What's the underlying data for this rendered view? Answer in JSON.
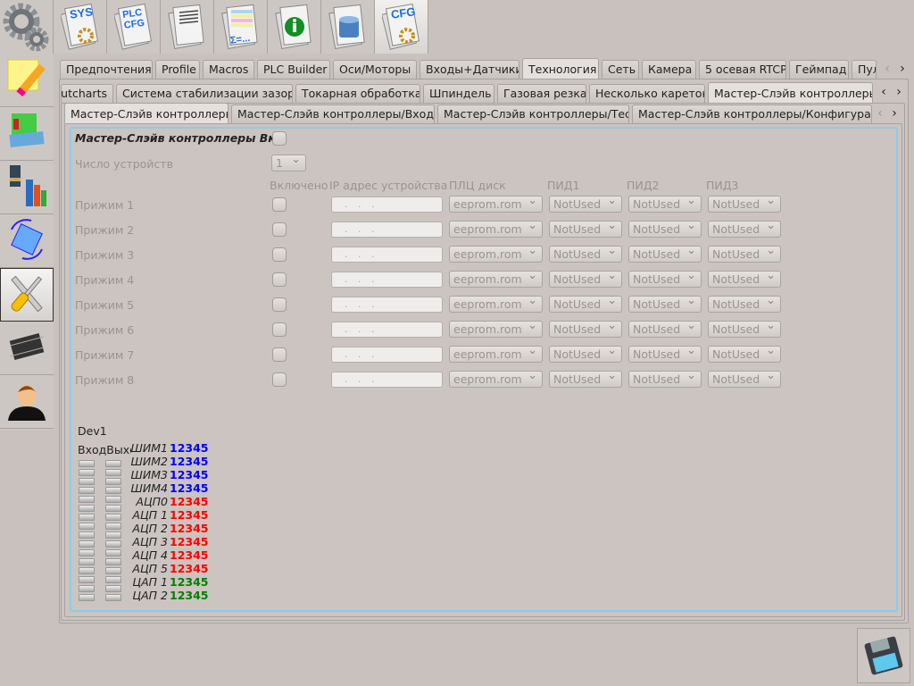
{
  "toolbar": {
    "items": [
      {
        "name": "sys-config",
        "text": "SYS"
      },
      {
        "name": "plc-config",
        "text": "PLC CFG"
      },
      {
        "name": "document",
        "text": ""
      },
      {
        "name": "formula-table",
        "text": "Σ=..."
      },
      {
        "name": "info",
        "text": ""
      },
      {
        "name": "database",
        "text": ""
      },
      {
        "name": "cfg",
        "text": "CFG"
      }
    ],
    "selected": 6
  },
  "sidebar": {
    "items": [
      "notes-pencil",
      "books",
      "microscope-chart",
      "rotate-mycnc",
      "tools",
      "chip",
      "user"
    ],
    "selected": 4
  },
  "tabs_l1": {
    "items": [
      "Предпочтения",
      "Profile",
      "Macros",
      "PLC Builder",
      "Оси/Моторы",
      "Входы+Датчики",
      "Технология",
      "Сеть",
      "Камера",
      "5 осевая RTCP",
      "Геймпад",
      "Пул"
    ],
    "selected": "Технология"
  },
  "tabs_l2": {
    "items": [
      "utcharts",
      "Система стабилизации зазора",
      "Токарная обработка",
      "Шпиндель",
      "Газовая резка",
      "Несколько кареток",
      "Мастер-Слэйв контроллеры"
    ],
    "selected": "Мастер-Слэйв контроллеры"
  },
  "tabs_l3": {
    "items": [
      "Мастер-Слэйв контроллеры",
      "Мастер-Слэйв контроллеры/Входы",
      "Мастер-Слэйв контроллеры/Тест",
      "Мастер-Слэйв контроллеры/Конфигурация"
    ],
    "selected": "Мастер-Слэйв контроллеры"
  },
  "form": {
    "enable_label": "Мастер-Слэйв контроллеры Вкл.",
    "enable_checked": false,
    "count_label": "Число устройств",
    "count_value": "1",
    "columns": [
      "Включено",
      "IP адрес устройства",
      "ПЛЦ диск",
      "ПИД1",
      "ПИД2",
      "ПИД3"
    ],
    "rows": [
      {
        "label": "Прижим 1",
        "enabled": false,
        "ip": ". . .",
        "disk": "eeprom.rom",
        "pid1": "NotUsed",
        "pid2": "NotUsed",
        "pid3": "NotUsed"
      },
      {
        "label": "Прижим 2",
        "enabled": false,
        "ip": ". . .",
        "disk": "eeprom.rom",
        "pid1": "NotUsed",
        "pid2": "NotUsed",
        "pid3": "NotUsed"
      },
      {
        "label": "Прижим 3",
        "enabled": false,
        "ip": ". . .",
        "disk": "eeprom.rom",
        "pid1": "NotUsed",
        "pid2": "NotUsed",
        "pid3": "NotUsed"
      },
      {
        "label": "Прижим 4",
        "enabled": false,
        "ip": ". . .",
        "disk": "eeprom.rom",
        "pid1": "NotUsed",
        "pid2": "NotUsed",
        "pid3": "NotUsed"
      },
      {
        "label": "Прижим 5",
        "enabled": false,
        "ip": ". . .",
        "disk": "eeprom.rom",
        "pid1": "NotUsed",
        "pid2": "NotUsed",
        "pid3": "NotUsed"
      },
      {
        "label": "Прижим 6",
        "enabled": false,
        "ip": ". . .",
        "disk": "eeprom.rom",
        "pid1": "NotUsed",
        "pid2": "NotUsed",
        "pid3": "NotUsed"
      },
      {
        "label": "Прижим 7",
        "enabled": false,
        "ip": ". . .",
        "disk": "eeprom.rom",
        "pid1": "NotUsed",
        "pid2": "NotUsed",
        "pid3": "NotUsed"
      },
      {
        "label": "Прижим 8",
        "enabled": false,
        "ip": ". . .",
        "disk": "eeprom.rom",
        "pid1": "NotUsed",
        "pid2": "NotUsed",
        "pid3": "NotUsed"
      }
    ]
  },
  "device": {
    "title": "Dev1",
    "io_header": "ВходВыхс",
    "signals": [
      {
        "name": "ШИМ1",
        "value": "12345",
        "color": "#0000ff"
      },
      {
        "name": "ШИМ2",
        "value": "12345",
        "color": "#0000ff"
      },
      {
        "name": "ШИМ3",
        "value": "12345",
        "color": "#0000ff"
      },
      {
        "name": "ШИМ4",
        "value": "12345",
        "color": "#0000ff"
      },
      {
        "name": "АЦП0",
        "value": "12345",
        "color": "#ff0000"
      },
      {
        "name": "АЦП 1",
        "value": "12345",
        "color": "#ff0000"
      },
      {
        "name": "АЦП 2",
        "value": "12345",
        "color": "#ff0000"
      },
      {
        "name": "АЦП 3",
        "value": "12345",
        "color": "#ff0000"
      },
      {
        "name": "АЦП 4",
        "value": "12345",
        "color": "#ff0000"
      },
      {
        "name": "АЦП 5",
        "value": "12345",
        "color": "#ff0000"
      },
      {
        "name": "ЦАП 1",
        "value": "12345",
        "color": "#008000"
      },
      {
        "name": "ЦАП 2",
        "value": "12345",
        "color": "#008000"
      }
    ]
  },
  "save": {
    "icon": "floppy-disk-icon"
  }
}
